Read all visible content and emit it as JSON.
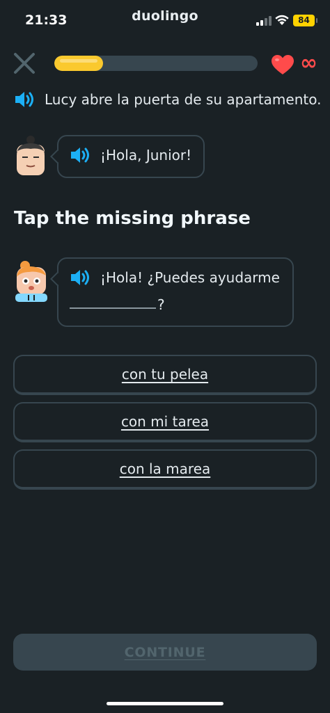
{
  "status_bar": {
    "time": "21:33",
    "app_name": "duolingo",
    "battery": "84",
    "signal_icon": "cellular-signal-icon",
    "wifi_icon": "wifi-icon"
  },
  "header": {
    "close_icon": "close-icon",
    "progress": 0.24,
    "hearts_icon": "heart-icon",
    "hearts_count": "∞",
    "colors": {
      "progress": "#fac92e",
      "heart": "#ff4b4b"
    }
  },
  "context": {
    "text": "Lucy abre la puerta de su apartamento.",
    "icon": "speaker-icon"
  },
  "dialogue": [
    {
      "speaker_avatar": "lucy-avatar",
      "text": "¡Hola, Junior!"
    },
    {
      "speaker_avatar": "junior-avatar",
      "text": "¡Hola! ¿Puedes ayudarme",
      "after_blank": "?"
    }
  ],
  "prompt": {
    "title": "Tap the missing phrase"
  },
  "options": [
    {
      "label": "con tu pelea"
    },
    {
      "label": "con mi tarea"
    },
    {
      "label": "con la marea"
    }
  ],
  "footer": {
    "continue_label": "CONTINUE"
  },
  "colors": {
    "background": "#1a2125",
    "border": "#37464f",
    "speaker": "#1cb0f6"
  }
}
